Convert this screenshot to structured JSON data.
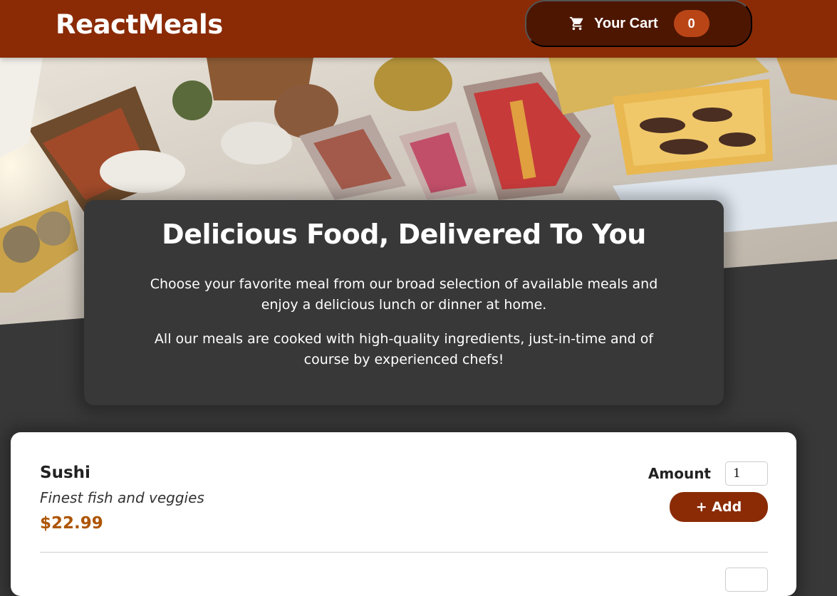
{
  "header": {
    "logo": "ReactMeals",
    "cart": {
      "label": "Your Cart",
      "count": "0",
      "icon": "cart-icon"
    }
  },
  "hero": {
    "image": "buffet-table-photo"
  },
  "summary": {
    "title": "Delicious Food, Delivered To You",
    "paragraph1": "Choose your favorite meal from our broad selection of available meals and enjoy a delicious lunch or dinner at home.",
    "paragraph2": "All our meals are cooked with high-quality ingredients, just-in-time and of course by experienced chefs!"
  },
  "meals": [
    {
      "name": "Sushi",
      "description": "Finest fish and veggies",
      "price": "$22.99",
      "amount_label": "Amount",
      "amount_value": "1",
      "add_label": "+ Add"
    }
  ],
  "colors": {
    "header": "#8a2b06",
    "cart_button": "#4d1601",
    "badge": "#b94517",
    "price": "#ad5502",
    "background": "#383838"
  }
}
